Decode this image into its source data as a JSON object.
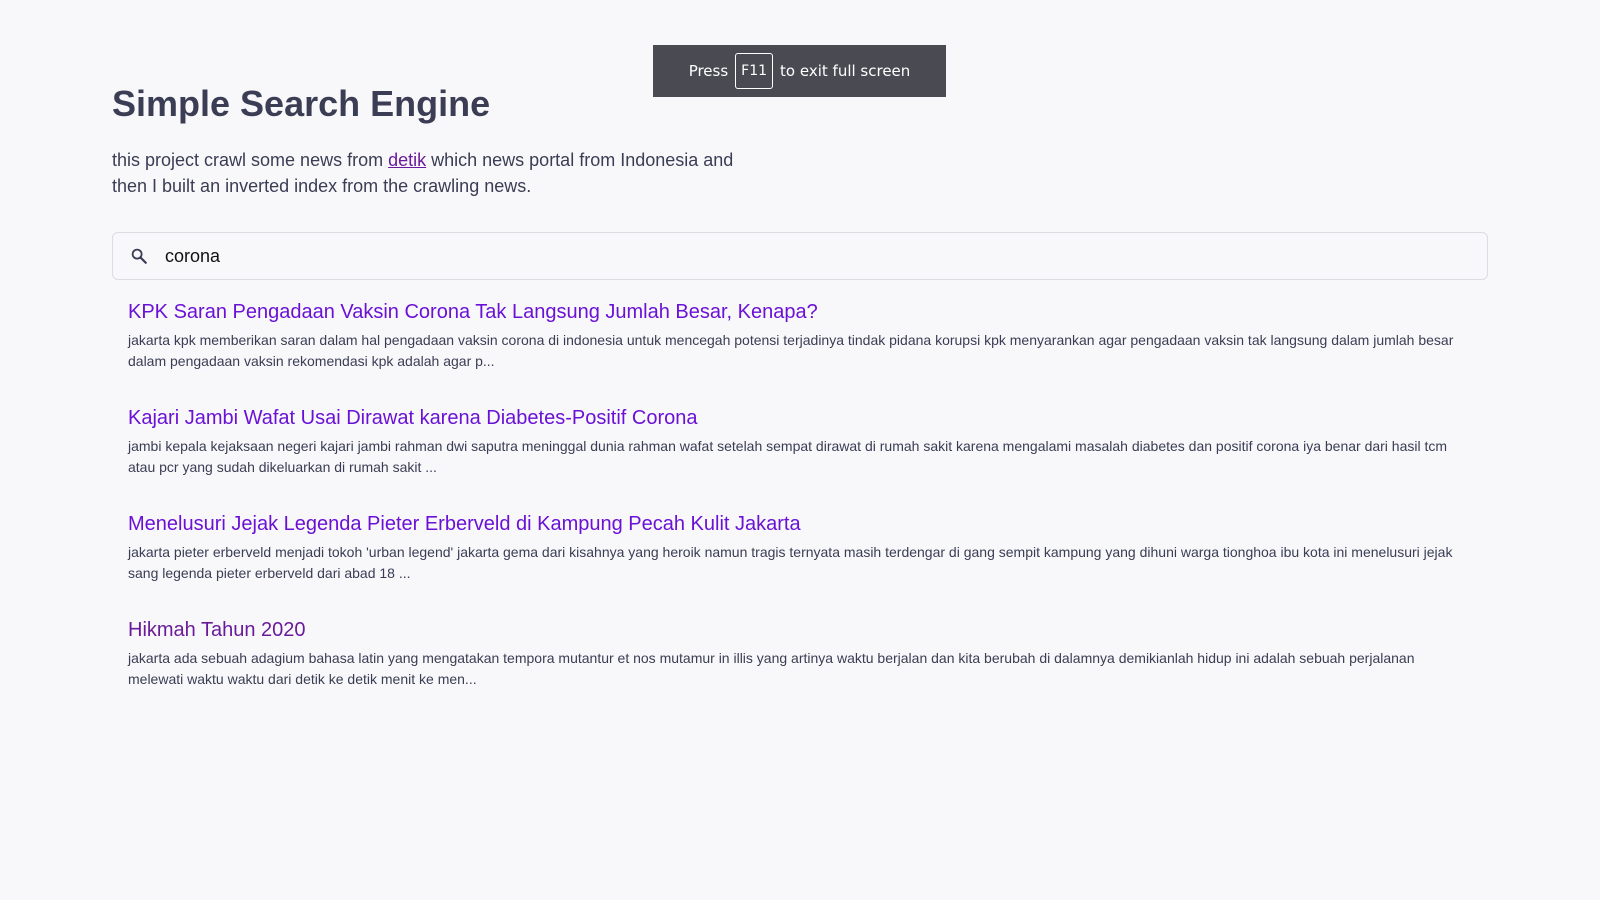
{
  "fullscreen_banner": {
    "press": "Press",
    "key": "F11",
    "suffix": "to exit full screen"
  },
  "page": {
    "title": "Simple Search Engine",
    "description_before": "this project crawl some news from ",
    "description_link": "detik",
    "description_after": " which news portal from Indonesia and then I built an inverted index from the crawling news."
  },
  "search": {
    "icon": "search-icon",
    "value": "corona"
  },
  "results": [
    {
      "title": "KPK Saran Pengadaan Vaksin Corona Tak Langsung Jumlah Besar, Kenapa?",
      "snippet": "jakarta kpk memberikan saran dalam hal pengadaan vaksin corona di indonesia untuk mencegah potensi terjadinya tindak pidana korupsi kpk menyarankan agar pengadaan vaksin tak langsung dalam jumlah besar dalam pengadaan vaksin rekomendasi kpk adalah agar p..."
    },
    {
      "title": "Kajari Jambi Wafat Usai Dirawat karena Diabetes-Positif Corona",
      "snippet": "jambi kepala kejaksaan negeri kajari jambi rahman dwi saputra meninggal dunia rahman wafat setelah sempat dirawat di rumah sakit karena mengalami masalah diabetes dan positif corona iya benar dari hasil tcm atau pcr yang sudah dikeluarkan di rumah sakit ..."
    },
    {
      "title": "Menelusuri Jejak Legenda Pieter Erberveld di Kampung Pecah Kulit Jakarta",
      "snippet": "jakarta pieter erberveld menjadi tokoh 'urban legend' jakarta gema dari kisahnya yang heroik namun tragis ternyata masih terdengar di gang sempit kampung yang dihuni warga tionghoa ibu kota ini menelusuri jejak sang legenda pieter erberveld dari abad 18 ..."
    },
    {
      "title": "Hikmah Tahun 2020",
      "snippet": "jakarta ada sebuah adagium bahasa latin yang mengatakan tempora mutantur et nos mutamur in illis yang artinya waktu berjalan dan kita berubah di dalamnya demikianlah hidup ini adalah sebuah perjalanan melewati waktu waktu dari detik ke detik menit ke men..."
    }
  ],
  "colors": {
    "background": "#f8f8fa",
    "heading": "#3a3d54",
    "result_link": "#6a11d6",
    "visited_link": "#6a1b9a",
    "banner_bg": "#4a4b52"
  }
}
